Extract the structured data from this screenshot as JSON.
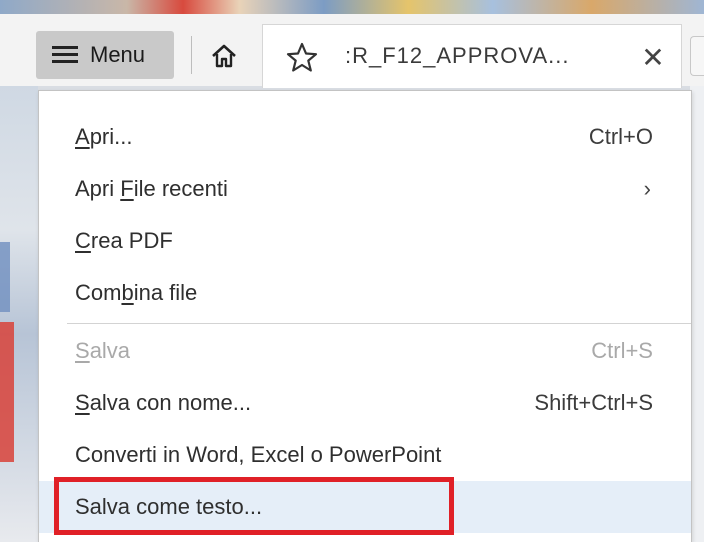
{
  "toolbar": {
    "menu_label": "Menu",
    "home_icon": "home-icon",
    "tab_title": ":R_F12_APPROVA...",
    "star_icon": "star-icon",
    "close_label": "✕"
  },
  "menu": {
    "items": [
      {
        "pre": "",
        "u": "A",
        "post": "pri...",
        "shortcut": "Ctrl+O",
        "state": "normal"
      },
      {
        "pre": "Apri ",
        "u": "F",
        "post": "ile recenti",
        "shortcut": "›",
        "state": "submenu"
      },
      {
        "pre": "",
        "u": "C",
        "post": "rea PDF",
        "shortcut": "",
        "state": "normal"
      },
      {
        "pre": "Com",
        "u": "b",
        "post": "ina file",
        "shortcut": "",
        "state": "normal"
      },
      {
        "pre": "",
        "u": "S",
        "post": "alva",
        "shortcut": "Ctrl+S",
        "state": "disabled"
      },
      {
        "pre": "",
        "u": "S",
        "post": "alva con nome...",
        "shortcut": "Shift+Ctrl+S",
        "state": "normal"
      },
      {
        "pre": "Converti in Word, Excel o PowerPoint",
        "u": "",
        "post": "",
        "shortcut": "",
        "state": "normal"
      },
      {
        "pre": "Salva come testo...",
        "u": "",
        "post": "",
        "shortcut": "",
        "state": "hovered"
      }
    ]
  },
  "colors": {
    "highlight_border": "#e02027",
    "hover_bg": "#e5eef8",
    "disabled_text": "#a9a9a9"
  }
}
